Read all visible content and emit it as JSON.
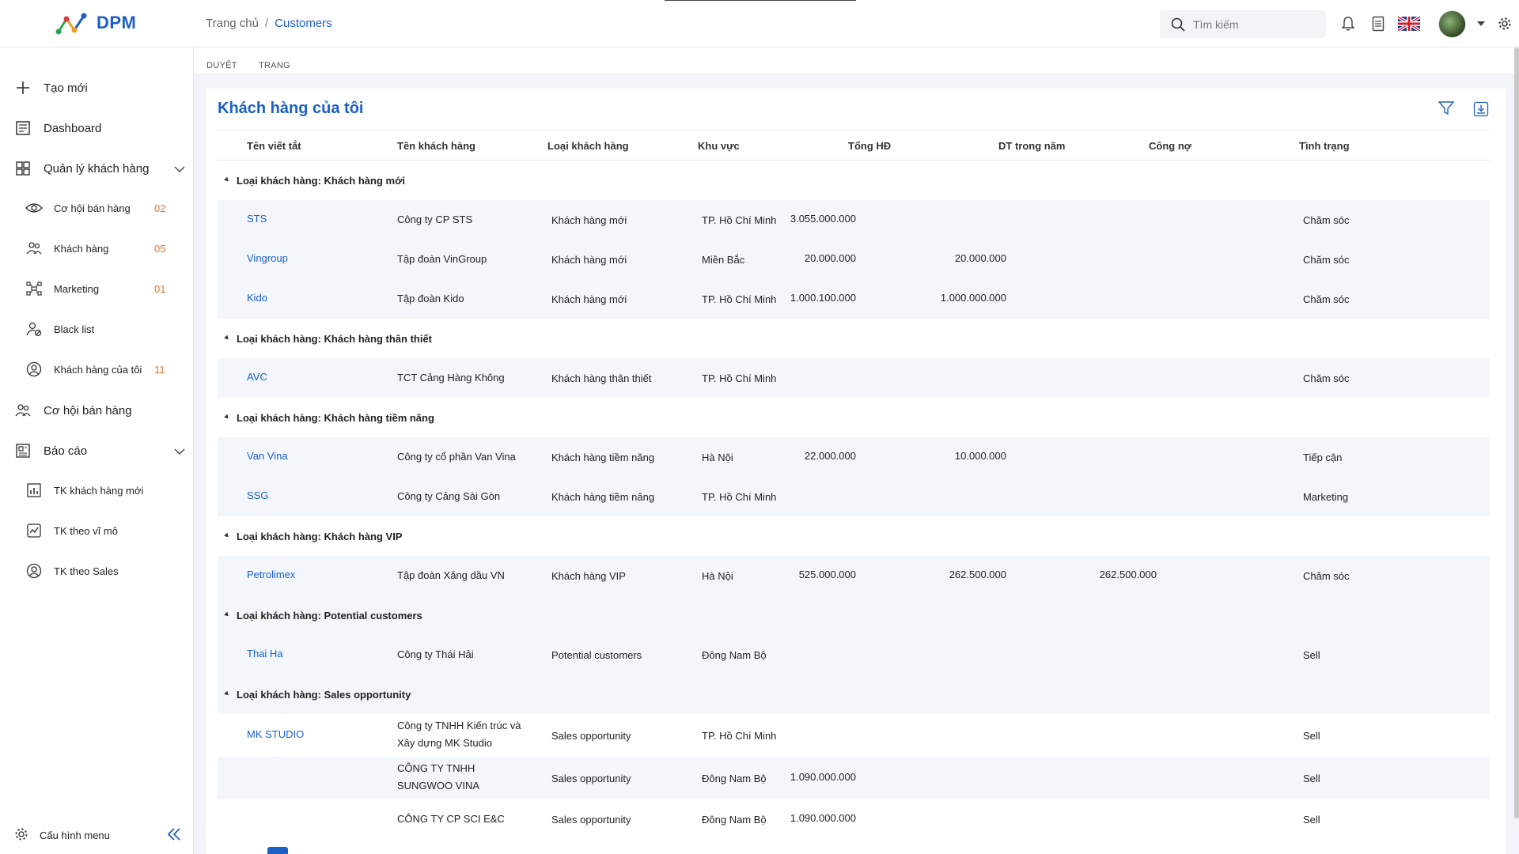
{
  "app": {
    "name": "DPM",
    "breadcrumb": {
      "home": "Trang chủ",
      "separator": "/",
      "current": "Customers"
    },
    "search_placeholder": "Tìm kiếm",
    "icons": [
      "search-icon",
      "bell-icon",
      "document-icon",
      "uk-flag-icon",
      "avatar",
      "chevron-down-icon",
      "gear-icon"
    ]
  },
  "sidebar": {
    "items": [
      {
        "label": "Tạo mới",
        "icon": "plus-icon"
      },
      {
        "label": "Dashboard",
        "icon": "dashboard-icon"
      },
      {
        "label": "Quản lý khách hàng",
        "icon": "grid-icon",
        "expanded": true
      },
      {
        "label": "Cơ hội bán hàng",
        "icon": "people-icon"
      },
      {
        "label": "Báo cáo",
        "icon": "report-icon",
        "expanded": true
      }
    ],
    "sub_customers": [
      {
        "label": "Cơ hội bán hàng",
        "count": "02",
        "icon": "eye-icon"
      },
      {
        "label": "Khách hàng",
        "count": "05",
        "icon": "people-icon"
      },
      {
        "label": "Marketing",
        "count": "01",
        "icon": "network-icon"
      },
      {
        "label": "Black list",
        "count": "",
        "icon": "user-block-icon"
      },
      {
        "label": "Khách hàng của tôi",
        "count": "11",
        "icon": "user-circle-icon"
      }
    ],
    "sub_reports": [
      {
        "label": "TK khách hàng mới",
        "icon": "chart-icon"
      },
      {
        "label": "TK theo vĩ mô",
        "icon": "chart-check-icon"
      },
      {
        "label": "TK theo Sales",
        "icon": "user-circle-icon"
      }
    ],
    "footer_label": "Cấu hình menu"
  },
  "tabs": [
    "DUYỆT",
    "TRANG"
  ],
  "panel": {
    "title": "Khách hàng của tôi",
    "columns": [
      "Tên viết tắt",
      "Tên khách hàng",
      "Loại khách hàng",
      "Khu vực",
      "Tổng HĐ",
      "DT trong năm",
      "Công nợ",
      "Tình trạng"
    ],
    "group_prefix": "Loại khách hàng: ",
    "groups": [
      {
        "name": "Khách hàng mới",
        "rows": [
          {
            "code": "STS",
            "name": [
              "Công ty CP STS"
            ],
            "type": "Khách hàng mới",
            "region": "TP. Hồ Chí Minh",
            "total": "3.055.000.000",
            "revenue": "",
            "debt": "",
            "status": "Chăm sóc"
          },
          {
            "code": "Vingroup",
            "name": [
              "Tập đoàn VinGroup"
            ],
            "type": "Khách hàng mới",
            "region": "Miền Bắc",
            "total": "20.000.000",
            "revenue": "20.000.000",
            "debt": "",
            "status": "Chăm sóc"
          },
          {
            "code": "Kido",
            "name": [
              "Tập đoàn Kido"
            ],
            "type": "Khách hàng mới",
            "region": "TP. Hồ Chí Minh",
            "total": "1.000.100.000",
            "revenue": "1.000.000.000",
            "debt": "",
            "status": "Chăm sóc"
          }
        ]
      },
      {
        "name": "Khách hàng thân thiết",
        "rows": [
          {
            "code": "AVC",
            "name": [
              "TCT Cảng Hàng Không"
            ],
            "type": "Khách hàng thân thiết",
            "region": "TP. Hồ Chí Minh",
            "total": "",
            "revenue": "",
            "debt": "",
            "status": "Chăm sóc"
          }
        ]
      },
      {
        "name": "Khách hàng tiềm năng",
        "rows": [
          {
            "code": "Van Vina",
            "name": [
              "Công ty cổ phần Van Vina"
            ],
            "type": "Khách hàng tiềm năng",
            "region": "Hà Nội",
            "total": "22.000.000",
            "revenue": "10.000.000",
            "debt": "",
            "status": "Tiếp cận"
          },
          {
            "code": "SSG",
            "name": [
              "Công ty Cảng Sài Gòn"
            ],
            "type": "Khách hàng tiềm năng",
            "region": "TP. Hồ Chí Minh",
            "total": "",
            "revenue": "",
            "debt": "",
            "status": "Marketing"
          }
        ]
      },
      {
        "name": "Khách hàng VIP",
        "rows": [
          {
            "code": "Petrolimex",
            "name": [
              "Tập đoàn Xăng dầu VN"
            ],
            "type": "Khách hàng VIP",
            "region": "Hà Nội",
            "total": "525.000.000",
            "revenue": "262.500.000",
            "debt": "262.500.000",
            "status": "Chăm sóc"
          }
        ]
      },
      {
        "name": "Potential customers",
        "rows": [
          {
            "code": "Thai Ha",
            "name": [
              "Công ty Thái Hải"
            ],
            "type": "Potential customers",
            "region": "Đông Nam Bộ",
            "total": "",
            "revenue": "",
            "debt": "",
            "status": "Sell"
          }
        ]
      },
      {
        "name": "Sales opportunity",
        "rows": [
          {
            "code": "MK STUDIO",
            "name": [
              "Công ty TNHH Kiến trúc và",
              "Xây dựng MK Studio"
            ],
            "type": "Sales opportunity",
            "region": "TP. Hồ Chí Minh",
            "total": "",
            "revenue": "",
            "debt": "",
            "status": "Sell"
          },
          {
            "code": "",
            "name": [
              "CÔNG TY TNHH",
              "SUNGWOO VINA"
            ],
            "type": "Sales opportunity",
            "region": "Đông Nam Bộ",
            "total": "1.090.000.000",
            "revenue": "",
            "debt": "",
            "status": "Sell"
          },
          {
            "code": "",
            "name": [
              "CÔNG TY CP SCI E&C"
            ],
            "type": "Sales opportunity",
            "region": "Đông Nam Bộ",
            "total": "1.090.000.000",
            "revenue": "",
            "debt": "",
            "status": "Sell"
          }
        ]
      }
    ]
  },
  "colors": {
    "brand": "#1b5fc8",
    "count": "#e8722a",
    "row_alt": "#f3f6fa",
    "page_bg": "#f1f4f8"
  }
}
